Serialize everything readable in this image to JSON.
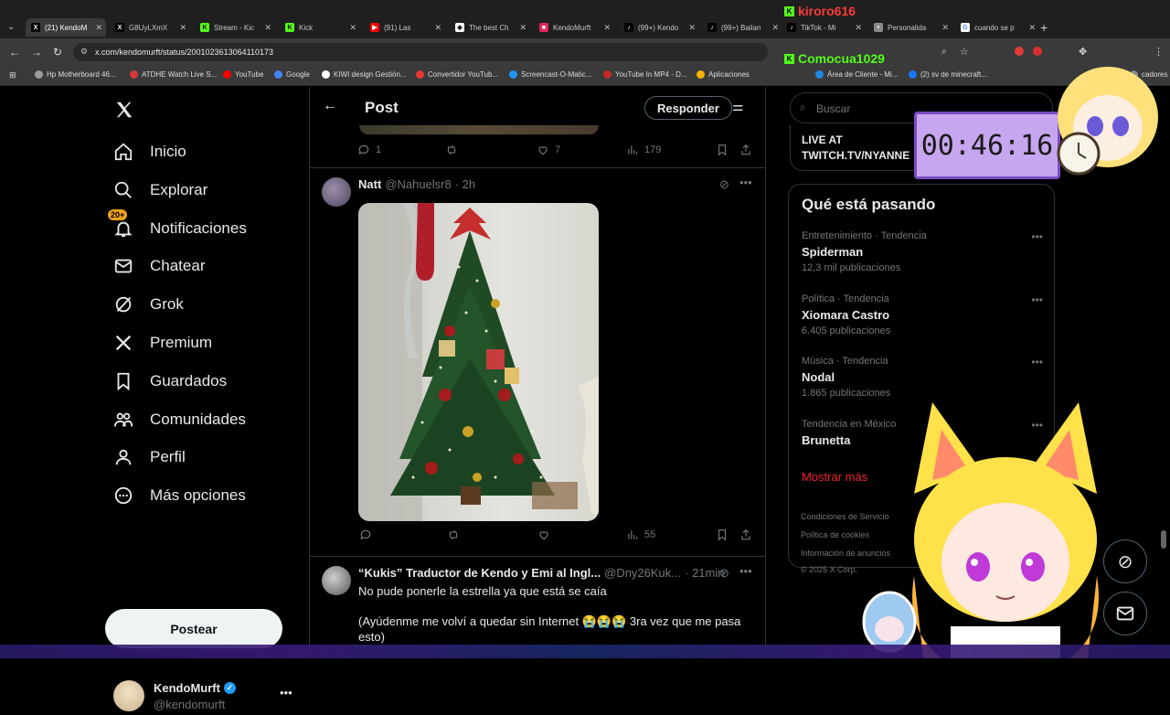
{
  "browser": {
    "tabs": [
      {
        "label": "(21) KendoM",
        "icon": "x-logo",
        "active": true
      },
      {
        "label": "G8UyLXmX",
        "icon": "x-logo"
      },
      {
        "label": "Stream - Kic",
        "icon": "kick-logo"
      },
      {
        "label": "Kick",
        "icon": "kick-logo"
      },
      {
        "label": "(91) Las",
        "icon": "youtube-logo"
      },
      {
        "label": "The best Ch",
        "icon": "openai-logo"
      },
      {
        "label": "KendoMurft",
        "icon": "square-logo"
      },
      {
        "label": "(99+) Kendo",
        "icon": "tiktok-logo"
      },
      {
        "label": "(99+) Bailan",
        "icon": "tiktok-logo"
      },
      {
        "label": "TikTok - Mi",
        "icon": "tiktok-logo"
      },
      {
        "label": "Personalida",
        "icon": "generic"
      },
      {
        "label": "cuando se p",
        "icon": "google-logo"
      }
    ],
    "url": "x.com/kendomurft/status/2001023613064110173",
    "bookmarks": [
      {
        "label": "Hp Motherboard 46...",
        "color": "#9c9c9c"
      },
      {
        "label": "ATDHE Watch Live S...",
        "color": "#d43a3a"
      },
      {
        "label": "YouTube",
        "color": "#ff0000"
      },
      {
        "label": "Google",
        "color": "#4285f4"
      },
      {
        "label": "KIWI design Gestión...",
        "color": "#ffffff"
      },
      {
        "label": "Convertidor YouTub...",
        "color": "#e53935"
      },
      {
        "label": "Screencast-O-Matic...",
        "color": "#2196f3"
      },
      {
        "label": "YouTube In MP4 - D...",
        "color": "#c62828"
      },
      {
        "label": "Aplicaciones",
        "color": "#f4b400"
      },
      {
        "label": "Área de Cliente - Mi...",
        "color": "#1e88e5"
      },
      {
        "label": "(2) sv de minecraft...",
        "color": "#1877f2"
      },
      {
        "label": "cadores",
        "color": "#888888"
      }
    ]
  },
  "sidebar": {
    "items": [
      {
        "label": "Inicio",
        "icon": "home-icon"
      },
      {
        "label": "Explorar",
        "icon": "search-icon"
      },
      {
        "label": "Notificaciones",
        "icon": "bell-icon",
        "badge": "20+"
      },
      {
        "label": "Chatear",
        "icon": "mail-icon"
      },
      {
        "label": "Grok",
        "icon": "grok-icon"
      },
      {
        "label": "Premium",
        "icon": "x-icon"
      },
      {
        "label": "Guardados",
        "icon": "bookmark-icon"
      },
      {
        "label": "Comunidades",
        "icon": "people-icon"
      },
      {
        "label": "Perfil",
        "icon": "person-icon"
      },
      {
        "label": "Más opciones",
        "icon": "more-circle-icon"
      }
    ],
    "post_label": "Postear",
    "account": {
      "name": "KendoMurft",
      "handle": "@kendomurft",
      "verified": true
    }
  },
  "main": {
    "header_title": "Post",
    "reply_button": "Responder",
    "top_actions": {
      "replies": "1",
      "likes": "7",
      "views": "179"
    },
    "tweets": [
      {
        "name": "Natt",
        "handle": "@Nahuelsr8",
        "time": "· 2h",
        "views": "55",
        "image_description": "christmas-tree-photo"
      },
      {
        "name": "“Kukis” Traductor de Kendo y Emi al Ingl...",
        "handle": "@Dny26Kuk...",
        "time": "· 21min",
        "text1": "No pude ponerle la estrella ya que está se caía",
        "text2": "(Ayúdenme me volví a quedar sin Internet 😭😭😭 3ra vez que me pasa esto)"
      }
    ]
  },
  "right": {
    "search_placeholder": "Buscar",
    "live_text": "LIVE AT TWITCH.TV/NYANNE",
    "trends_title": "Qué está pasando",
    "trends": [
      {
        "category": "Entretenimiento · Tendencia",
        "name": "Spiderman",
        "count": "12,3 mil publicaciones"
      },
      {
        "category": "Política · Tendencia",
        "name": "Xiomara Castro",
        "count": "6.405 publicaciones"
      },
      {
        "category": "Música · Tendencia",
        "name": "Nodal",
        "count": "1.865 publicaciones"
      },
      {
        "category": "Tendencia en México",
        "name": "Brunetta",
        "count": ""
      }
    ],
    "show_more": "Mostrar más",
    "footer": [
      "Condiciones de Servicio",
      "Política de cookies",
      "Información de anuncios",
      "© 2025 X Corp."
    ]
  },
  "overlay": {
    "timer": "00:46:16",
    "chat_user1": "kiroro616",
    "chat_user2": "Comocua1029"
  },
  "colors": {
    "accent": "#1d9bf0",
    "link_red": "#f4212e",
    "kick_green": "#53fc18"
  }
}
